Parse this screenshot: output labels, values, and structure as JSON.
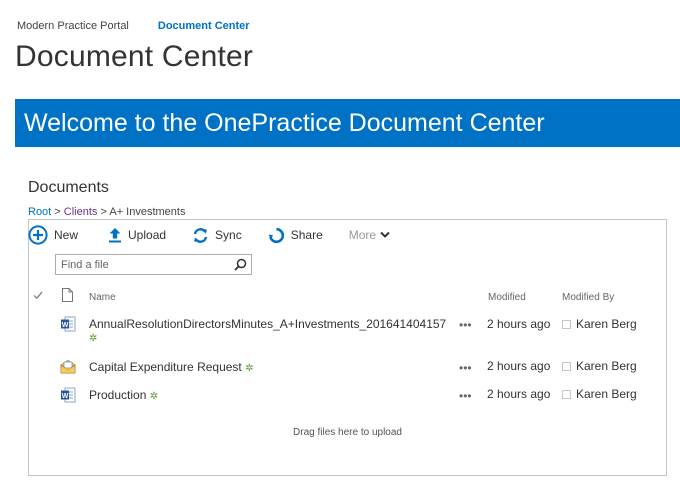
{
  "topnav": {
    "site": "Modern Practice Portal",
    "current": "Document Center"
  },
  "page_title": "Document Center",
  "banner": {
    "text": "Welcome to the OnePractice Document Center",
    "color": "#0072c6"
  },
  "documents_title": "Documents",
  "breadcrumb": {
    "root": "Root",
    "sep1": " > ",
    "clients": "Clients",
    "sep2": " > ",
    "current": "A+ Investments"
  },
  "toolbar": {
    "new_label": "New",
    "upload_label": "Upload",
    "sync_label": "Sync",
    "share_label": "Share",
    "more_label": "More"
  },
  "search": {
    "placeholder": "Find a file"
  },
  "columns": {
    "name": "Name",
    "modified": "Modified",
    "modified_by": "Modified By"
  },
  "files": [
    {
      "icon": "word-document-icon",
      "name": "AnnualResolutionDirectorsMinutes_A+Investments_201641404157",
      "new_marker": "✲",
      "ellipsis": "•••",
      "modified": "2 hours ago",
      "modified_by": "Karen Berg"
    },
    {
      "icon": "email-message-icon",
      "name": "Capital Expenditure Request",
      "new_marker": "✲",
      "ellipsis": "•••",
      "modified": "2 hours ago",
      "modified_by": "Karen Berg"
    },
    {
      "icon": "word-document-icon",
      "name": "Production",
      "new_marker": "✲",
      "ellipsis": "•••",
      "modified": "2 hours ago",
      "modified_by": "Karen Berg"
    }
  ],
  "dropzone_text": "Drag files here to upload"
}
